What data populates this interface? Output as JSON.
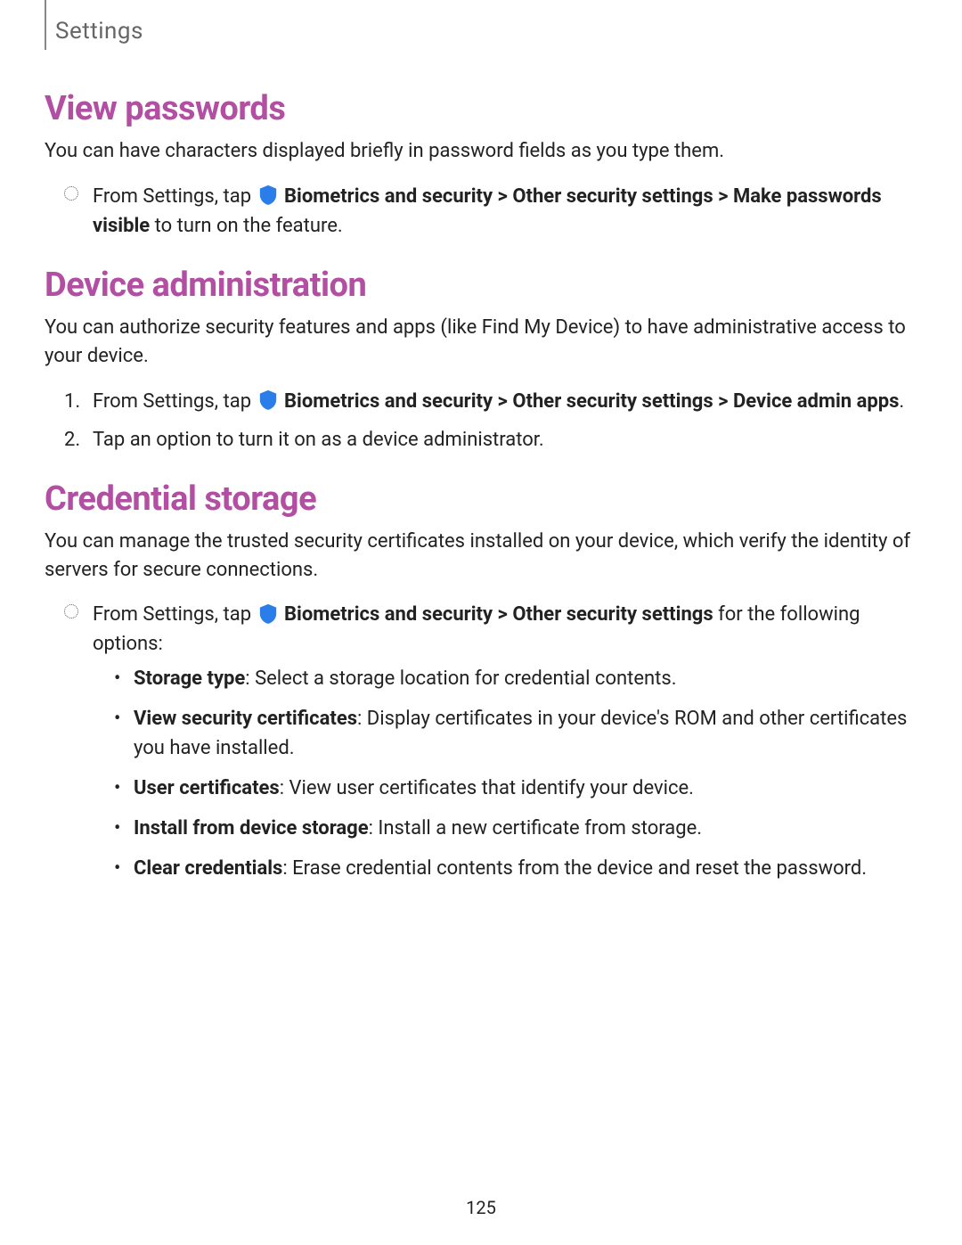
{
  "header": {
    "label": "Settings"
  },
  "sections": {
    "view_passwords": {
      "heading": "View passwords",
      "intro": "You can have characters displayed briefly in password fields as you type them.",
      "step_prefix": "From Settings, tap ",
      "path1": "Biometrics and security",
      "chev": ">",
      "path2": "Other security settings",
      "path3": "Make passwords visible",
      "step_suffix": " to turn on the feature."
    },
    "device_admin": {
      "heading": "Device administration",
      "intro": "You can authorize security features and apps (like Find My Device) to have administrative access to your device.",
      "n1": "1.",
      "n2": "2.",
      "step1_prefix": "From Settings, tap ",
      "path1": "Biometrics and security",
      "chev": ">",
      "path2": "Other security settings",
      "path3": "Device admin apps",
      "step1_suffix": ".",
      "step2": "Tap an option to turn it on as a device administrator."
    },
    "credential_storage": {
      "heading": "Credential storage",
      "intro": "You can manage the trusted security certificates installed on your device, which verify the identity of servers for secure connections.",
      "step_prefix": "From Settings, tap ",
      "path1": "Biometrics and security",
      "chev": ">",
      "path2": "Other security settings",
      "step_suffix": " for the following options:",
      "bullets": {
        "b1_label": "Storage type",
        "b1_text": ": Select a storage location for credential contents.",
        "b2_label": "View security certificates",
        "b2_text": ": Display certificates in your device's ROM and other certificates you have installed.",
        "b3_label": "User certificates",
        "b3_text": ": View user certificates that identify your device.",
        "b4_label": "Install from device storage",
        "b4_text": ": Install a new certificate from storage.",
        "b5_label": "Clear credentials",
        "b5_text": ": Erase credential contents from the device and reset the password."
      }
    }
  },
  "page_number": "125"
}
